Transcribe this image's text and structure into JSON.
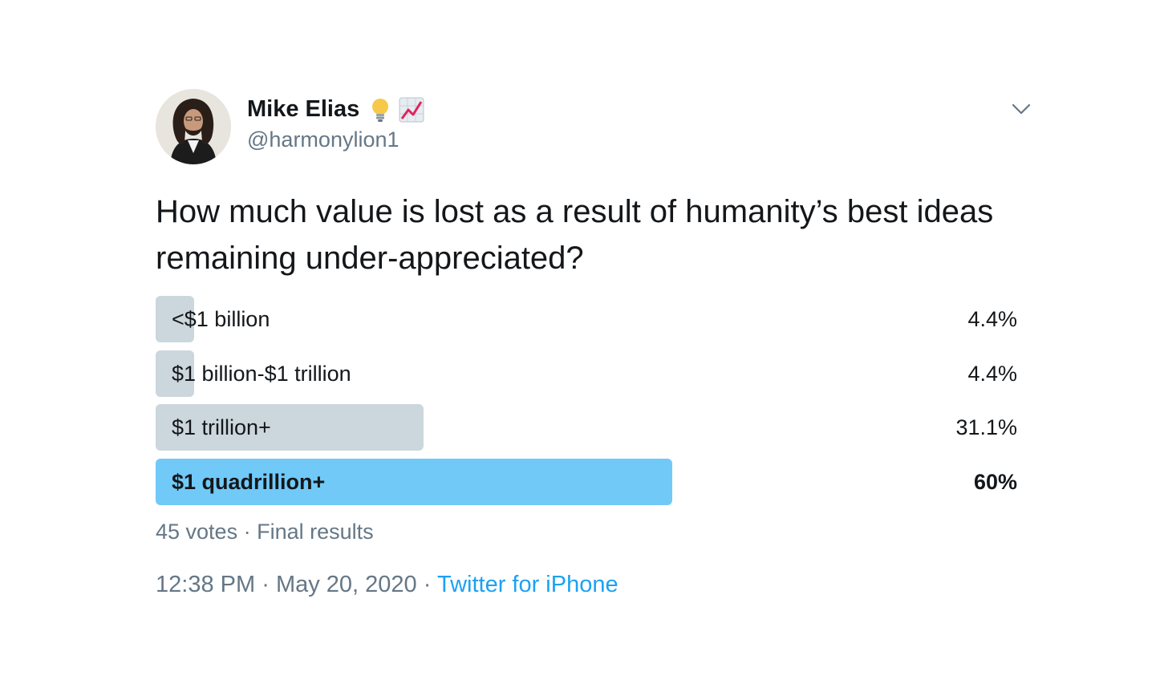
{
  "author": {
    "display_name": "Mike Elias",
    "handle": "@harmonylion1",
    "name_icons": [
      "lightbulb-emoji-icon",
      "chart-increasing-emoji-icon"
    ]
  },
  "tweet": {
    "text": "How much value is lost as a result of humanity’s best ideas remaining under-appreciated?"
  },
  "poll": {
    "options": [
      {
        "label": "<$1 billion",
        "percent_text": "4.4%",
        "percent": 4.4,
        "winner": false
      },
      {
        "label": "$1 billion-$1 trillion",
        "percent_text": "4.4%",
        "percent": 4.4,
        "winner": false
      },
      {
        "label": "$1 trillion+",
        "percent_text": "31.1%",
        "percent": 31.1,
        "winner": false
      },
      {
        "label": "$1 quadrillion+",
        "percent_text": "60%",
        "percent": 60,
        "winner": true
      }
    ],
    "votes": "45 votes",
    "separator": "·",
    "status": "Final results"
  },
  "meta": {
    "time": "12:38 PM",
    "date": "May 20, 2020",
    "separator": "·",
    "source": "Twitter for iPhone"
  },
  "colors": {
    "bar": "#ccd6dd",
    "bar_winner": "#71c9f8",
    "link": "#1da1f2",
    "secondary_text": "#657786",
    "primary_text": "#14171a"
  }
}
